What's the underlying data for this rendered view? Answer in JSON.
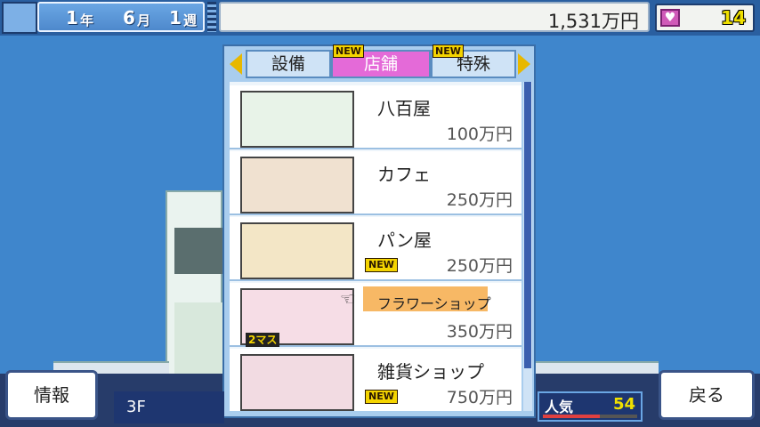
{
  "header": {
    "year": "1",
    "year_unit": "年",
    "month": "6",
    "month_unit": "月",
    "week": "1",
    "week_unit": "週",
    "money": "1,531万円",
    "hearts": "14"
  },
  "tabs": [
    {
      "label": "設備",
      "new": false,
      "active": false
    },
    {
      "label": "店舗",
      "new": true,
      "active": true
    },
    {
      "label": "特殊",
      "new": true,
      "active": false
    }
  ],
  "new_label": "NEW",
  "shops": [
    {
      "name": "八百屋",
      "price": "100万円",
      "new": false,
      "thumb_color": "#e8f3e8"
    },
    {
      "name": "カフェ",
      "price": "250万円",
      "new": false,
      "thumb_color": "#f0e1d0"
    },
    {
      "name": "パン屋",
      "price": "250万円",
      "new": true,
      "thumb_color": "#f3e6c6"
    },
    {
      "name": "フラワーショップ",
      "price": "350万円",
      "new": false,
      "thumb_color": "#f6dde6",
      "size_badge": "2マス",
      "selected": true
    },
    {
      "name": "雑貨ショップ",
      "price": "750万円",
      "new": true,
      "thumb_color": "#f2dbe2"
    }
  ],
  "footer": {
    "info_label": "情報",
    "floor_label": "3F",
    "popularity_label": "人気",
    "popularity_value": "54",
    "back_label": "戻る"
  },
  "colors": {
    "sky": "#3f86cc",
    "tab_active": "#e46ad8",
    "highlight": "#f7b865",
    "accent_yellow": "#f4d400"
  },
  "icons": [
    "calendar-icon",
    "gripper-icon",
    "heart-icon",
    "arrow-left-icon",
    "arrow-right-icon",
    "pointer-hand-icon"
  ]
}
